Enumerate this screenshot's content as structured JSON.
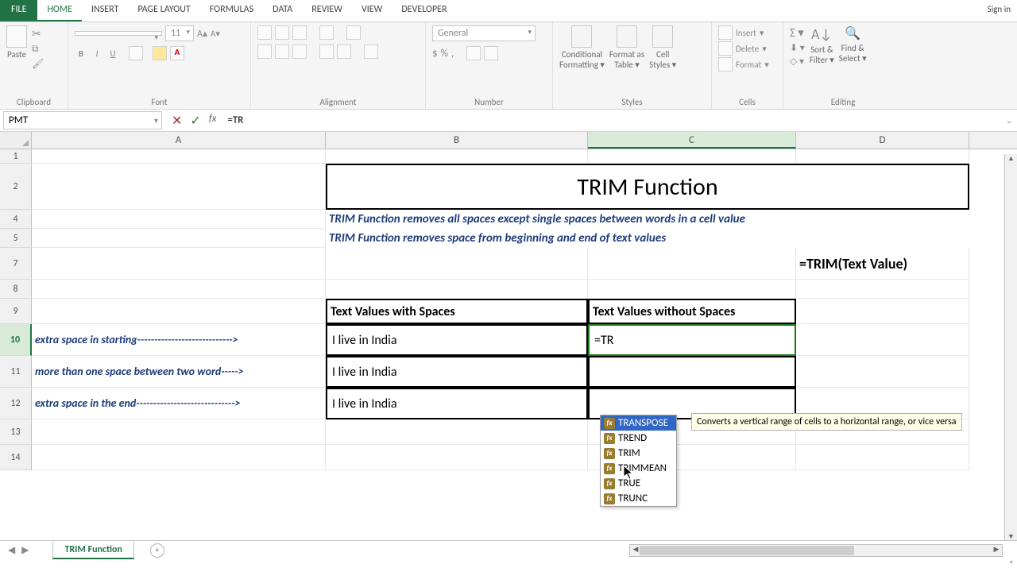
{
  "tabs": {
    "file": "FILE",
    "items": [
      "HOME",
      "INSERT",
      "PAGE LAYOUT",
      "FORMULAS",
      "DATA",
      "REVIEW",
      "VIEW",
      "DEVELOPER"
    ],
    "active": "HOME",
    "signin": "Sign in"
  },
  "ribbon": {
    "clipboard": {
      "paste": "Paste",
      "label": "Clipboard"
    },
    "font": {
      "size": "11",
      "label": "Font"
    },
    "alignment": {
      "label": "Alignment"
    },
    "number": {
      "format": "General",
      "label": "Number"
    },
    "styles": {
      "cf": "Conditional",
      "cf2": "Formatting",
      "fat": "Format as",
      "fat2": "Table",
      "cs": "Cell",
      "cs2": "Styles",
      "label": "Styles"
    },
    "cells": {
      "insert": "Insert",
      "delete": "Delete",
      "format": "Format",
      "label": "Cells"
    },
    "editing": {
      "sort": "Sort &",
      "sort2": "Filter",
      "find": "Find &",
      "find2": "Select",
      "label": "Editing"
    }
  },
  "namebox": "PMT",
  "formula": "=TR",
  "columns": [
    "A",
    "B",
    "C",
    "D"
  ],
  "rows_visible": [
    "1",
    "2",
    "4",
    "5",
    "7",
    "8",
    "9",
    "10",
    "11",
    "12",
    "13",
    "14"
  ],
  "active_row": "10",
  "active_col": "C",
  "content": {
    "title": "TRIM Function",
    "desc_line1": "TRIM Function removes all spaces except single spaces between words in a cell value",
    "desc_line2": "TRIM Function removes space from beginning and end of text values",
    "syntax": "=TRIM(Text Value)",
    "hdr_b": "Text Values with Spaces",
    "hdr_c": "Text Values without Spaces",
    "row10_a": "extra space in starting---------------------------->",
    "row10_b": "  I live in India",
    "row10_c": "=TR",
    "row11_a": "more than one space between two word----->",
    "row11_b": "I live    in India",
    "row12_a": "extra space in the end----------------------------->",
    "row12_b": "I live in India"
  },
  "autocomplete": {
    "items": [
      "TRANSPOSE",
      "TREND",
      "TRIM",
      "TRIMMEAN",
      "TRUE",
      "TRUNC"
    ],
    "selected": "TRANSPOSE",
    "tooltip": "Converts a vertical range of cells to a horizontal range, or vice versa"
  },
  "sheet": {
    "name": "TRIM Function"
  }
}
